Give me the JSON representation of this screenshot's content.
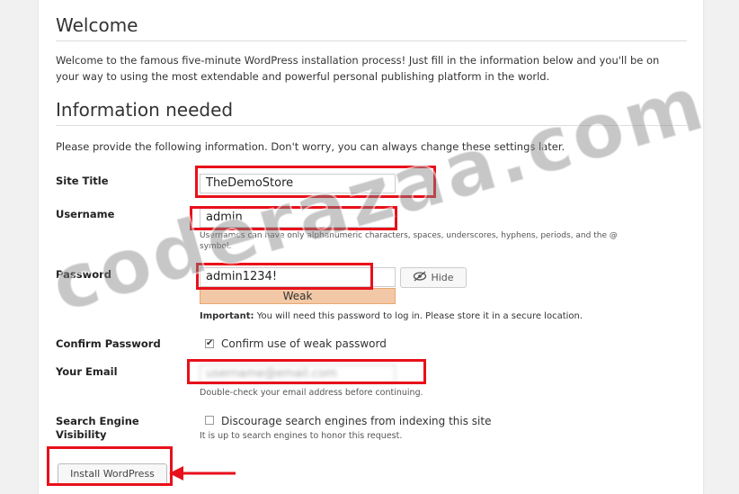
{
  "welcome": {
    "title": "Welcome",
    "text": "Welcome to the famous five-minute WordPress installation process! Just fill in the information below and you'll be on your way to using the most extendable and powerful personal publishing platform in the world."
  },
  "info": {
    "title": "Information needed",
    "text": "Please provide the following information. Don't worry, you can always change these settings later."
  },
  "form": {
    "site_title": {
      "label": "Site Title",
      "value": "TheDemoStore"
    },
    "username": {
      "label": "Username",
      "value": "admin",
      "hint": "Usernames can have only alphanumeric characters, spaces, underscores, hyphens, periods, and the @ symbol."
    },
    "password": {
      "label": "Password",
      "value": "admin1234!",
      "hide_label": "Hide",
      "strength": "Weak",
      "important_label": "Important:",
      "important_text": " You will need this password to log in. Please store it in a secure location."
    },
    "confirm_password": {
      "label": "Confirm Password",
      "checkbox_label": "Confirm use of weak password",
      "checked": true
    },
    "email": {
      "label": "Your Email",
      "value": "username@email.com",
      "hint": "Double-check your email address before continuing."
    },
    "search_engine": {
      "label_line1": "Search Engine",
      "label_line2": "Visibility",
      "checkbox_label": "Discourage search engines from indexing this site",
      "hint": "It is up to search engines to honor this request.",
      "checked": false
    },
    "submit_label": "Install WordPress"
  },
  "watermark": "coderazaa.com",
  "colors": {
    "highlight": "#e8101a",
    "weak_bg": "#f3c8a6"
  }
}
